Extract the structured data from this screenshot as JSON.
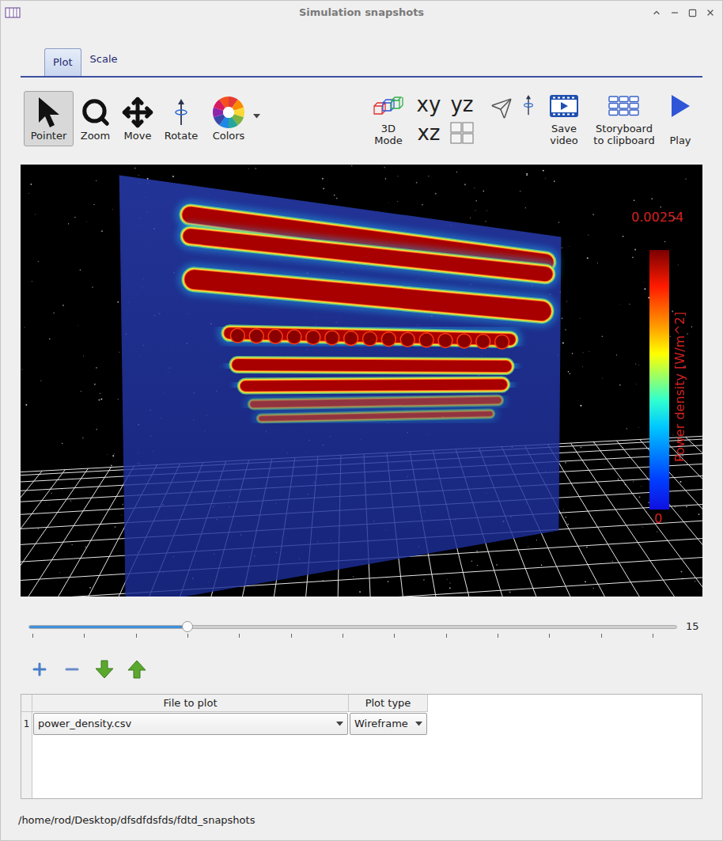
{
  "window": {
    "title": "Simulation snapshots"
  },
  "tabs": [
    {
      "label": "Plot",
      "selected": true
    },
    {
      "label": "Scale",
      "selected": false
    }
  ],
  "toolbar": {
    "tools": [
      {
        "label": "Pointer",
        "selected": true,
        "has_menu": false
      },
      {
        "label": "Zoom",
        "selected": false,
        "has_menu": false
      },
      {
        "label": "Move",
        "selected": false,
        "has_menu": false
      },
      {
        "label": "Rotate",
        "selected": false,
        "has_menu": false
      },
      {
        "label": "Colors",
        "selected": false,
        "has_menu": true
      }
    ],
    "view_mode": {
      "label_lines": [
        "3D",
        "Mode"
      ]
    },
    "planes": [
      "xy",
      "yz",
      "xz"
    ],
    "actions": [
      {
        "label_lines": [
          "Save",
          "video"
        ]
      },
      {
        "label_lines": [
          "Storyboard",
          "to clipboard"
        ]
      },
      {
        "label_lines": [
          "Play"
        ]
      }
    ]
  },
  "plot": {
    "colorbar": {
      "max": "0.00254",
      "min": "0",
      "label": "Power density [W/m^2]"
    }
  },
  "slider": {
    "level": 0.245,
    "value": "15"
  },
  "table": {
    "columns": [
      "File to plot",
      "Plot type"
    ],
    "rows": [
      {
        "index": "1",
        "file": "power_density.csv",
        "plot_type": "Wireframe"
      }
    ]
  },
  "status_bar": "/home/rod/Desktop/dfsdfdsfds/fdtd_snapshots"
}
